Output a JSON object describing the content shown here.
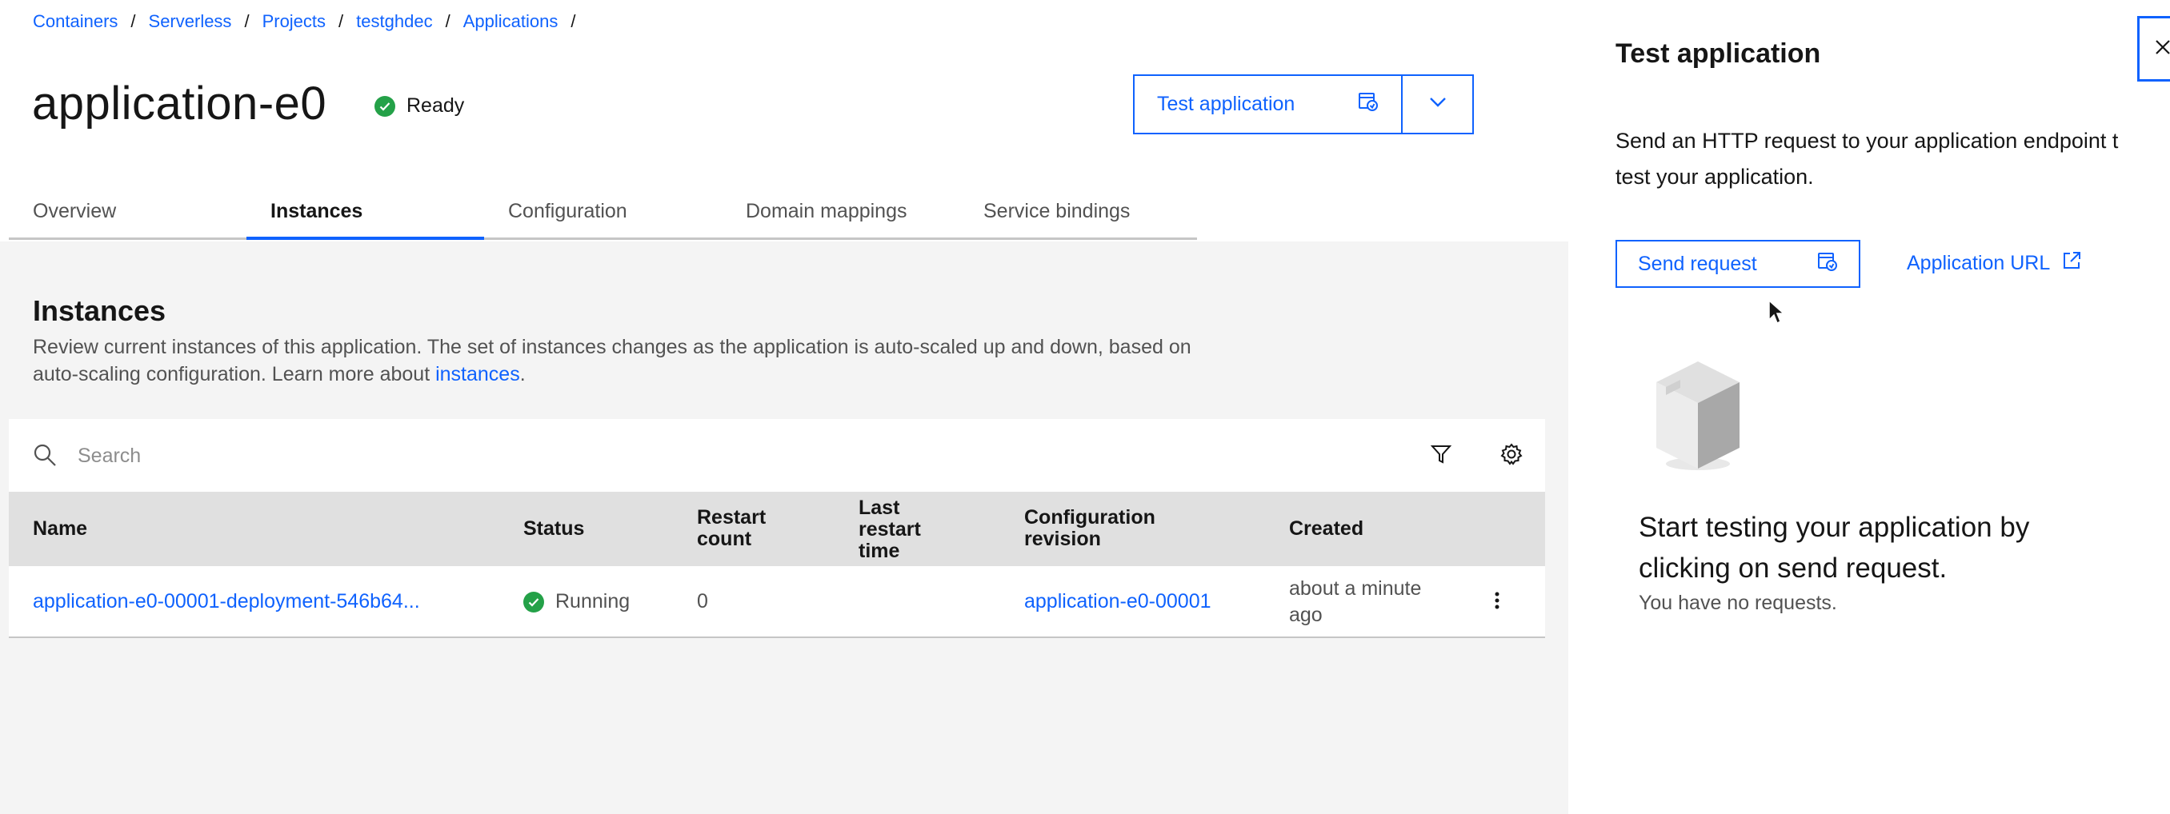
{
  "breadcrumb": [
    "Containers",
    "Serverless",
    "Projects",
    "testghdec",
    "Applications"
  ],
  "breadcrumb_separator": "/",
  "page": {
    "title": "application-e0",
    "status": "Ready",
    "test_button_label": "Test application"
  },
  "tabs": [
    {
      "label": "Overview",
      "active": false
    },
    {
      "label": "Instances",
      "active": true
    },
    {
      "label": "Configuration",
      "active": false
    },
    {
      "label": "Domain mappings",
      "active": false
    },
    {
      "label": "Service bindings",
      "active": false
    }
  ],
  "instances": {
    "title": "Instances",
    "description": "Review current instances of this application. The set of instances changes as the application is auto-scaled up and down, based on auto-scaling configuration. Learn more about ",
    "description_link": "instances",
    "description_end": ".",
    "search_placeholder": "Search",
    "columns": {
      "name": "Name",
      "status": "Status",
      "restart_count": "Restart count",
      "last_restart": "Last restart time",
      "config_revision": "Configuration revision",
      "created": "Created"
    },
    "rows": [
      {
        "name": "application-e0-00001-deployment-546b64...",
        "status": "Running",
        "restart_count": "0",
        "last_restart": "",
        "config_revision": "application-e0-00001",
        "created": "about a minute ago"
      }
    ]
  },
  "panel": {
    "title": "Test application",
    "description_line1": "Send an HTTP request to your application endpoint t",
    "description_line2": "test your application.",
    "send_button_label": "Send request",
    "app_url_label": "Application URL",
    "empty_title": "Start testing your application by clicking on send request.",
    "empty_subtitle": "You have no requests."
  },
  "colors": {
    "accent": "#0f62fe",
    "success": "#24a148",
    "layer": "#f4f4f4",
    "table_header": "#e0e0e0"
  },
  "icons": [
    "search-icon",
    "filter-icon",
    "settings-icon",
    "send-request-icon",
    "chevron-down-icon",
    "launch-icon",
    "overflow-menu-icon",
    "checkmark-filled-icon",
    "close-icon",
    "cursor-icon",
    "empty-box-illustration"
  ]
}
